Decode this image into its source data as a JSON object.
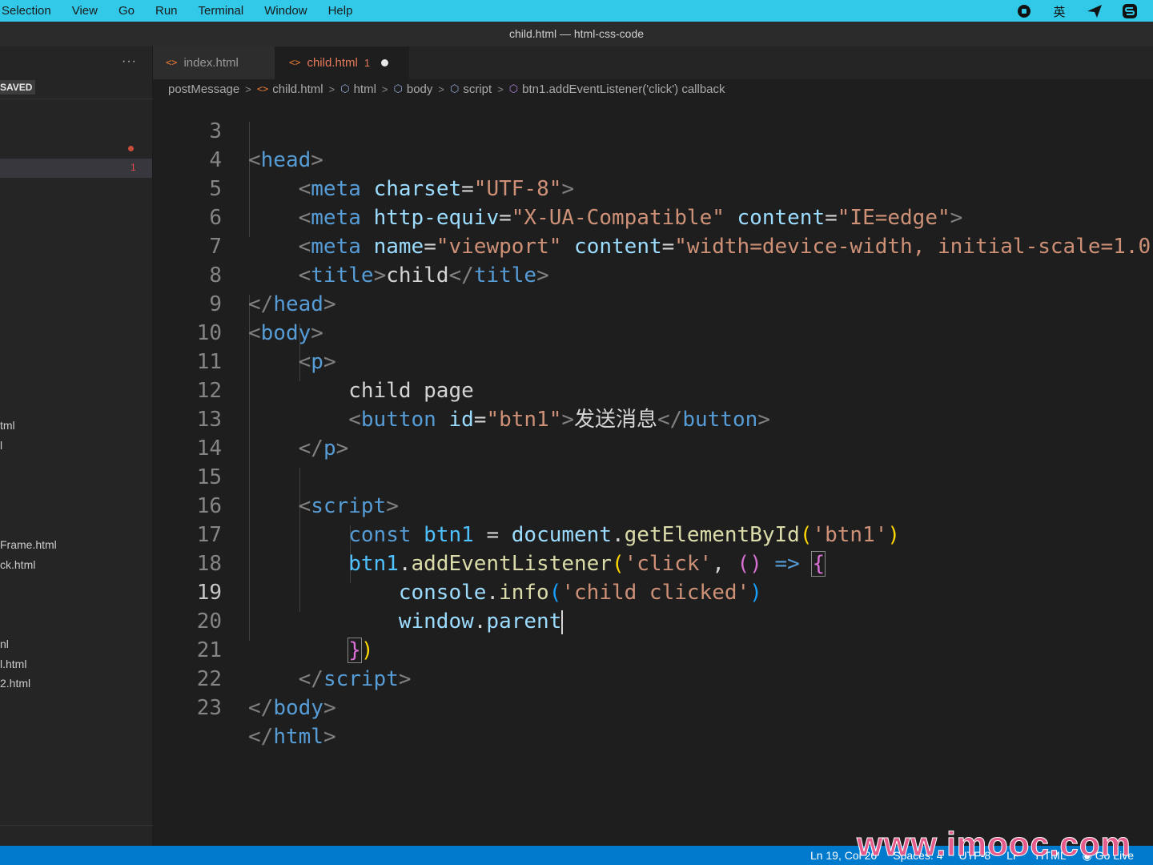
{
  "menubar": {
    "items": [
      "Selection",
      "View",
      "Go",
      "Run",
      "Terminal",
      "Window",
      "Help"
    ],
    "tray": [
      "record-icon",
      "英",
      "send-icon",
      "s-icon"
    ]
  },
  "window": {
    "title": "child.html — html-css-code"
  },
  "sidebar": {
    "more": "···",
    "unsaved_label": "SAVED",
    "active_badge": "1",
    "files": [
      "tml",
      "l",
      "Frame.html",
      "ck.html",
      "nl",
      "l.html",
      "2.html"
    ]
  },
  "tabs": [
    {
      "label": "index.html",
      "active": false
    },
    {
      "label": "child.html",
      "active": true,
      "badge": "1",
      "dirty": true
    }
  ],
  "breadcrumb": [
    "postMessage",
    "child.html",
    "html",
    "body",
    "script",
    "btn1.addEventListener('click') callback"
  ],
  "editor": {
    "current_line": 19,
    "line_numbers": [
      "3",
      "4",
      "5",
      "6",
      "7",
      "8",
      "9",
      "10",
      "11",
      "12",
      "13",
      "14",
      "15",
      "16",
      "17",
      "18",
      "19",
      "20",
      "21",
      "22",
      "23"
    ],
    "lines": {
      "l3": {
        "t": "head"
      },
      "l4": {
        "tag": "meta",
        "attr": "charset",
        "val": "\"UTF-8\""
      },
      "l5": {
        "tag": "meta",
        "attr1": "http-equiv",
        "val1": "\"X-UA-Compatible\"",
        "attr2": "content",
        "val2": "\"IE=edge\""
      },
      "l6": {
        "tag": "meta",
        "attr1": "name",
        "val1": "\"viewport\"",
        "attr2": "content",
        "val2": "\"width=device-width, initial-scale=1.0\""
      },
      "l7": {
        "tag": "title",
        "text": "child"
      },
      "l8": {
        "tag": "head"
      },
      "l9": {
        "tag": "body"
      },
      "l10": {
        "tag": "p"
      },
      "l11": {
        "text": "child page"
      },
      "l12": {
        "tag": "button",
        "attr": "id",
        "val": "\"btn1\"",
        "text": "发送消息"
      },
      "l13": {
        "tag": "p"
      },
      "l15": {
        "tag": "script"
      },
      "l16": {
        "kw": "const",
        "var": "btn1",
        "eq": "=",
        "obj": "document",
        "fn": "getElementById",
        "arg": "'btn1'"
      },
      "l17": {
        "obj": "btn1",
        "fn": "addEventListener",
        "arg": "'click'",
        "arrow": "=>"
      },
      "l18": {
        "obj": "console",
        "fn": "info",
        "arg": "'child clicked'"
      },
      "l19": {
        "obj": "window",
        "prop": "parent"
      },
      "l21": {
        "tag": "script"
      },
      "l22": {
        "tag": "body"
      },
      "l23": {
        "tag": "html"
      }
    }
  },
  "statusbar": {
    "position": "Ln 19, Col 26",
    "spaces": "Spaces: 4",
    "encoding": "UTF-8",
    "eol": "LF",
    "language": "HTML",
    "golive": "Go Live"
  },
  "watermark": "www.imooc.com",
  "colors": {
    "menubar": "#32c9e8",
    "statusbar": "#007acc",
    "tag": "#569cd6",
    "string": "#ce9178",
    "attr": "#9cdcfe"
  }
}
